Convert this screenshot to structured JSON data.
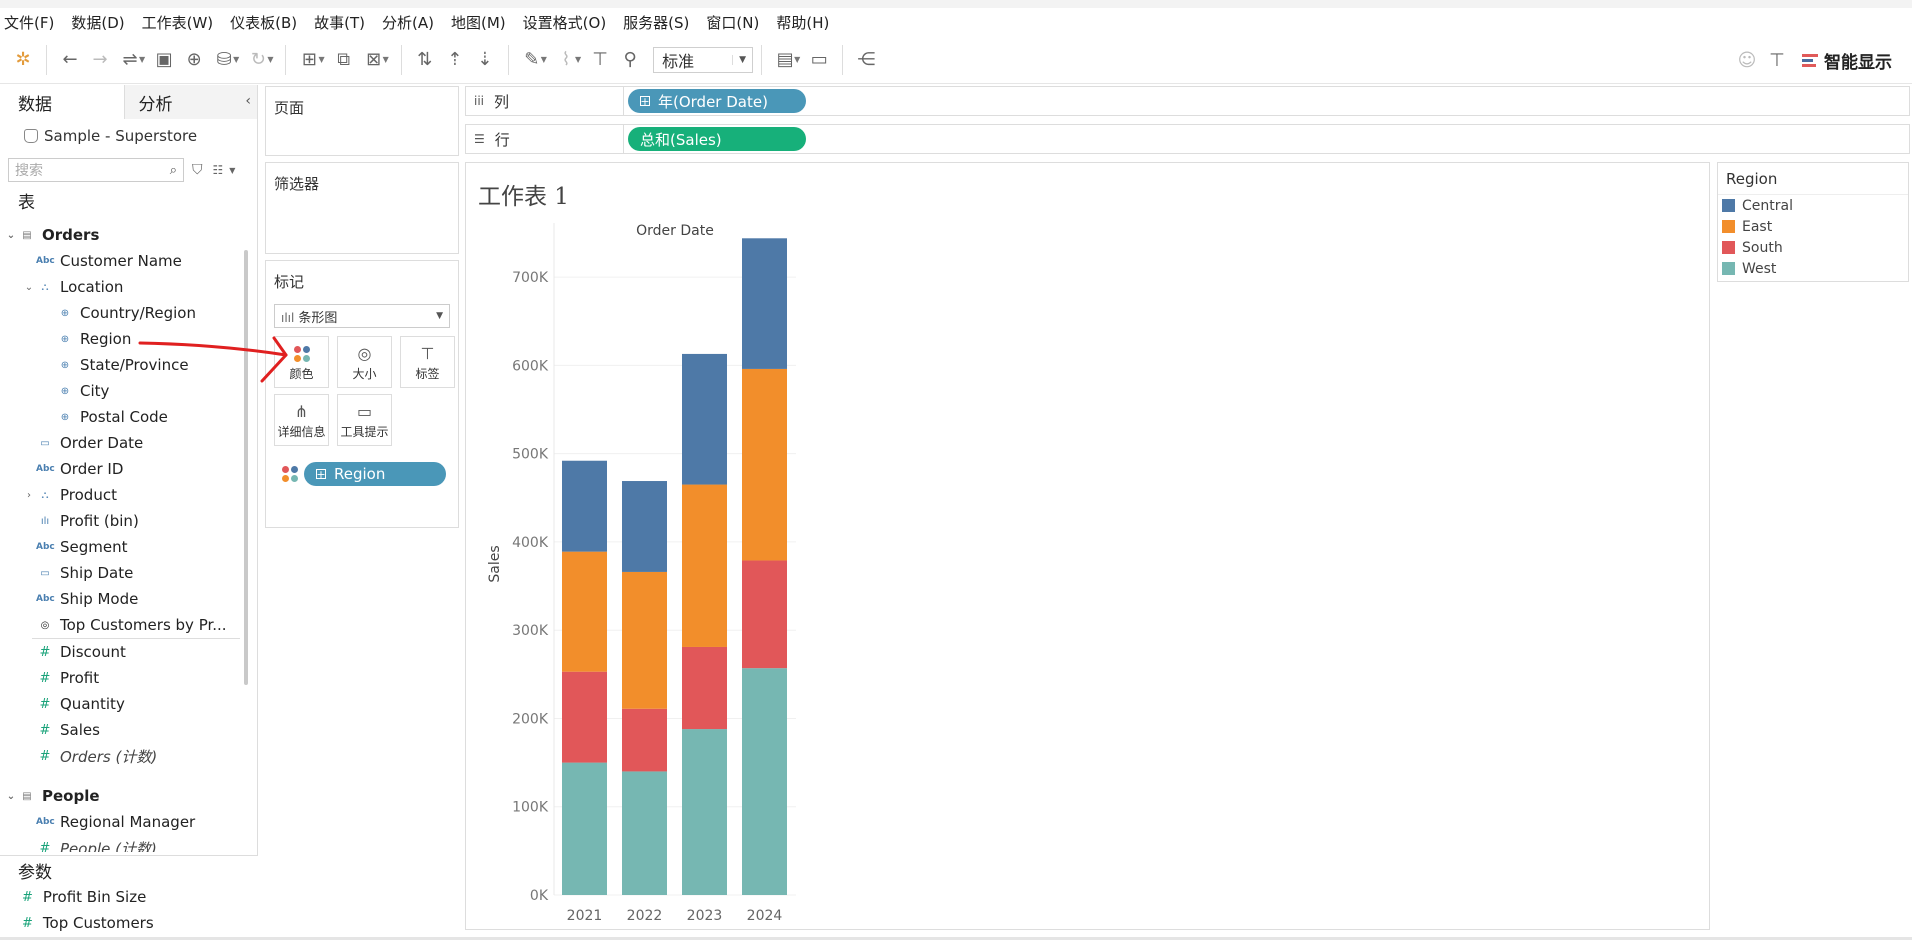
{
  "menu": [
    "文件(F)",
    "数据(D)",
    "工作表(W)",
    "仪表板(B)",
    "故事(T)",
    "分析(A)",
    "地图(M)",
    "设置格式(O)",
    "服务器(S)",
    "窗口(N)",
    "帮助(H)"
  ],
  "toolbar": {
    "fit_select": "标准",
    "smart_show": "智能显示"
  },
  "left_panel": {
    "tab_data": "数据",
    "tab_analysis": "分析",
    "datasource": "Sample - Superstore",
    "search_placeholder": "搜索",
    "tables_label": "表",
    "fields": [
      {
        "label": "Orders",
        "icon": "table",
        "indent": 0,
        "expand": "open",
        "kind": "table"
      },
      {
        "label": "Customer Name",
        "icon": "abc",
        "indent": 1
      },
      {
        "label": "Location",
        "icon": "hier",
        "indent": 1,
        "expand": "open"
      },
      {
        "label": "Country/Region",
        "icon": "geo",
        "indent": 2
      },
      {
        "label": "Region",
        "icon": "geo",
        "indent": 2
      },
      {
        "label": "State/Province",
        "icon": "geo",
        "indent": 2
      },
      {
        "label": "City",
        "icon": "geo",
        "indent": 2
      },
      {
        "label": "Postal Code",
        "icon": "geo",
        "indent": 2
      },
      {
        "label": "Order Date",
        "icon": "date",
        "indent": 1
      },
      {
        "label": "Order ID",
        "icon": "abc",
        "indent": 1
      },
      {
        "label": "Product",
        "icon": "hier",
        "indent": 1,
        "expand": "closed"
      },
      {
        "label": "Profit (bin)",
        "icon": "bin",
        "indent": 1
      },
      {
        "label": "Segment",
        "icon": "abc",
        "indent": 1
      },
      {
        "label": "Ship Date",
        "icon": "date",
        "indent": 1
      },
      {
        "label": "Ship Mode",
        "icon": "abc",
        "indent": 1
      },
      {
        "label": "Top Customers by Pr...",
        "icon": "set",
        "indent": 1,
        "divider_after": true
      },
      {
        "label": "Discount",
        "icon": "num",
        "indent": 1
      },
      {
        "label": "Profit",
        "icon": "num",
        "indent": 1
      },
      {
        "label": "Quantity",
        "icon": "num",
        "indent": 1
      },
      {
        "label": "Sales",
        "icon": "num",
        "indent": 1
      },
      {
        "label": "Orders (计数)",
        "icon": "num",
        "indent": 1,
        "italic": true,
        "gap_after": true
      },
      {
        "label": "People",
        "icon": "table",
        "indent": 0,
        "expand": "open",
        "kind": "table"
      },
      {
        "label": "Regional Manager",
        "icon": "abc",
        "indent": 1
      },
      {
        "label": "People (计数)",
        "icon": "num",
        "indent": 1,
        "italic": true
      }
    ],
    "params_label": "参数",
    "params": [
      "Profit Bin Size",
      "Top Customers"
    ]
  },
  "cards": {
    "pages": "页面",
    "filters": "筛选器",
    "marks": "标记",
    "mark_type": "条形图",
    "buttons": [
      "颜色",
      "大小",
      "标签",
      "详细信息",
      "工具提示"
    ],
    "color_pill": "Region"
  },
  "shelves": {
    "columns_label": "列",
    "columns_pill": "年(Order Date)",
    "rows_label": "行",
    "rows_pill": "总和(Sales)"
  },
  "colors": {
    "Central": "#4e79a7",
    "East": "#f28e2b",
    "South": "#e15759",
    "West": "#76b7b2"
  },
  "chart_data": {
    "type": "bar",
    "stacked": true,
    "title": "工作表 1",
    "x_header": "Order Date",
    "ylabel": "Sales",
    "categories": [
      "2021",
      "2022",
      "2023",
      "2024"
    ],
    "series": [
      {
        "name": "West",
        "values": [
          150000,
          140000,
          188000,
          257000
        ]
      },
      {
        "name": "South",
        "values": [
          103000,
          71000,
          93000,
          122000
        ]
      },
      {
        "name": "East",
        "values": [
          136000,
          155000,
          184000,
          217000
        ]
      },
      {
        "name": "Central",
        "values": [
          103000,
          103000,
          148000,
          148000
        ]
      }
    ],
    "ylim": [
      0,
      750000
    ],
    "yticks": [
      "0K",
      "100K",
      "200K",
      "300K",
      "400K",
      "500K",
      "600K",
      "700K"
    ],
    "legend_title": "Region",
    "legend": [
      "Central",
      "East",
      "South",
      "West"
    ],
    "legend_position": "right"
  }
}
